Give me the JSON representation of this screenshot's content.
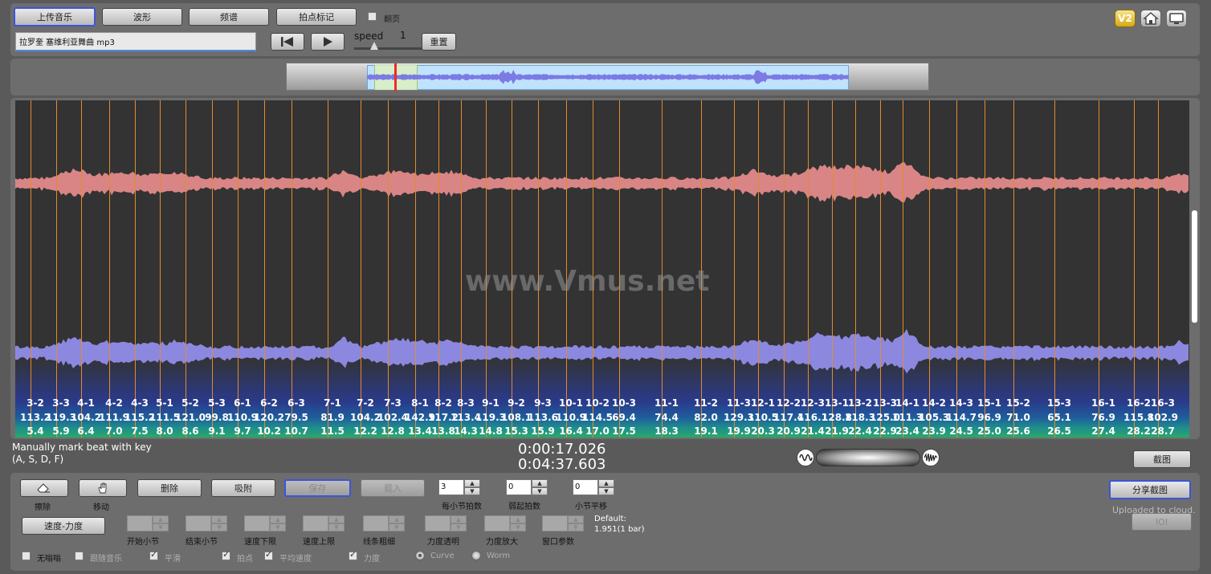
{
  "toolbar": {
    "upload": "上传音乐",
    "waveform": "波形",
    "spectrum": "频谱",
    "beat_mark": "拍点标记",
    "flip_page": "翻页",
    "filename": "拉罗奎 塞维利亚舞曲 mp3",
    "speed_label": "speed",
    "speed_value": "1",
    "reset": "重置",
    "v2_badge": "V2"
  },
  "viewer": {
    "watermark": "www.Vmus.net",
    "beat_labels": [
      "3-2",
      "3-3",
      "4-1",
      "4-2",
      "4-3",
      "5-1",
      "5-2",
      "5-3",
      "6-1",
      "6-2",
      "6-3",
      "7-1",
      "7-2",
      "7-3",
      "8-1",
      "8-2",
      "8-3",
      "9-1",
      "9-2",
      "9-3",
      "10-1",
      "10-2",
      "10-3",
      "11-1",
      "11-2",
      "11-3",
      "12-1",
      "12-2",
      "12-3",
      "13-1",
      "13-2",
      "13-3",
      "14-1",
      "14-2",
      "14-3",
      "15-1",
      "15-2",
      "15-3",
      "16-1",
      "16-2",
      "16-3"
    ],
    "tempo_values": [
      "113.2",
      "119.3",
      "104.2",
      "111.9",
      "115.2",
      "111.5",
      "121.0",
      "99.8",
      "110.9",
      "120.2",
      "79.5",
      "81.9",
      "104.2",
      "102.4",
      "142.9",
      "117.2",
      "113.4",
      "119.3",
      "108.1",
      "113.6",
      "110.9",
      "114.5",
      "69.4",
      "74.4",
      "82.0",
      "129.3",
      "110.5",
      "117.4",
      "116.1",
      "128.8",
      "118.3",
      "125.0",
      "111.3",
      "105.3",
      "114.7",
      "96.9",
      "71.0",
      "65.1",
      "76.9",
      "115.8",
      "102.9"
    ],
    "time_values": [
      "5.4",
      "5.9",
      "6.4",
      "7.0",
      "7.5",
      "8.0",
      "8.6",
      "9.1",
      "9.7",
      "10.2",
      "10.7",
      "11.5",
      "12.2",
      "12.8",
      "13.4",
      "13.8",
      "14.3",
      "14.8",
      "15.3",
      "15.9",
      "16.4",
      "17.0",
      "17.5",
      "18.3",
      "19.1",
      "19.9",
      "20.3",
      "20.9",
      "21.4",
      "21.9",
      "22.4",
      "22.9",
      "23.4",
      "23.9",
      "24.5",
      "25.0",
      "25.6",
      "26.5",
      "27.4",
      "28.2",
      "28.7"
    ],
    "beat_x": [
      44,
      76,
      107,
      142,
      174,
      205,
      237,
      270,
      302,
      335,
      369,
      414,
      455,
      489,
      523,
      552,
      580,
      611,
      643,
      676,
      711,
      744,
      777,
      830,
      879,
      920,
      950,
      982,
      1012,
      1042,
      1071,
      1102,
      1130,
      1163,
      1197,
      1232,
      1268,
      1319,
      1374,
      1418,
      1448
    ]
  },
  "status": {
    "hint_line1": "Manually mark beat with key",
    "hint_line2": "(A, S, D, F)",
    "current_time": "0:00:17.026",
    "total_time": "0:04:37.603",
    "screenshot": "截图"
  },
  "controls": {
    "erase": "擦除",
    "move": "移动",
    "delete": "删除",
    "snap": "吸附",
    "save": "保存",
    "load": "载入",
    "beats_per_bar_label": "每小节拍数",
    "beats_per_bar_value": "3",
    "pickup_beats_label": "弱起拍数",
    "pickup_beats_value": "0",
    "bar_shift_label": "小节平移",
    "bar_shift_value": "0",
    "share_screenshot": "分享截图",
    "uploaded": "Uploaded to cloud.",
    "ioi": "IOI",
    "tempo_dynamics": "速度-力度",
    "start_bar": "开始小节",
    "end_bar": "结束小节",
    "tempo_min": "速度下限",
    "tempo_max": "速度上限",
    "line_width": "线条粗细",
    "dyn_transparency": "力度透明",
    "dyn_scale": "力度放大",
    "window_param": "窗口参数",
    "default_label": "Default:",
    "default_value": "1.951(1 bar)",
    "no_drone": "无嗡嗡",
    "follow_music": "跟随音乐",
    "smooth": "平滑",
    "beats": "拍点",
    "avg_tempo": "平均速度",
    "dynamics": "力度",
    "curve": "Curve",
    "worm": "Worm"
  },
  "colors": {
    "tick": "#e38a2e",
    "upper_wave": "#d98585",
    "lower_wave": "#8c88e0",
    "viewer_bg": "#333333"
  }
}
